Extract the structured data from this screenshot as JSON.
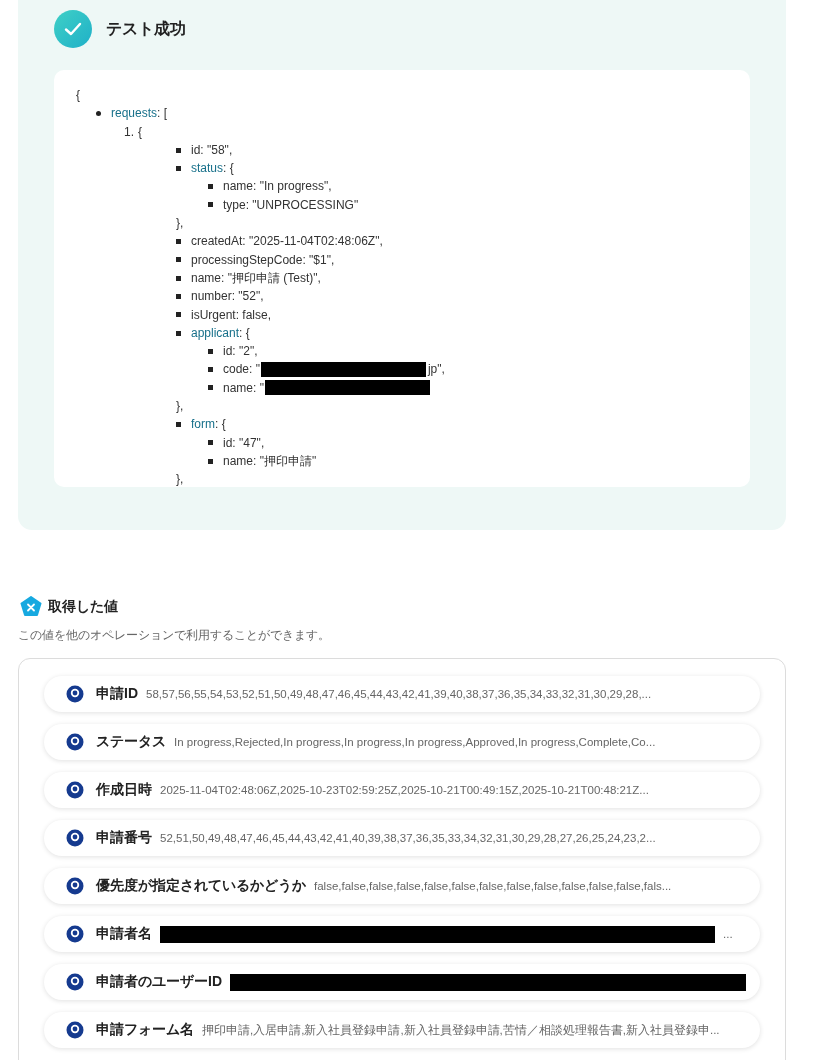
{
  "test_result": {
    "title": "テスト成功",
    "success": true,
    "json_view": {
      "open": "{",
      "items": [
        {
          "key": "requests",
          "text": ": [",
          "entries": [
            {
              "marker": "1.",
              "text": "{",
              "fields": [
                {
                  "text": "id: \"58\","
                },
                {
                  "key": "status",
                  "text": ": {",
                  "children": [
                    {
                      "text": "name: \"In progress\","
                    },
                    {
                      "text": "type: \"UNPROCESSING\""
                    }
                  ],
                  "close": "},"
                },
                {
                  "text": "createdAt: \"2025-11-04T02:48:06Z\","
                },
                {
                  "text": "processingStepCode: \"$1\","
                },
                {
                  "text": "name: \"押印申請 (Test)\","
                },
                {
                  "text": "number: \"52\","
                },
                {
                  "text": "isUrgent: false,"
                },
                {
                  "key": "applicant",
                  "text": ": {",
                  "children": [
                    {
                      "text": "id: \"2\","
                    },
                    {
                      "text": "code: \"",
                      "redacted": true,
                      "after": "jp\","
                    },
                    {
                      "text": "name: \"",
                      "redacted": true
                    }
                  ],
                  "close": "},"
                },
                {
                  "key": "form",
                  "text": ": {",
                  "children": [
                    {
                      "text": "id: \"47\","
                    },
                    {
                      "text": "name: \"押印申請\""
                    }
                  ],
                  "close": "},"
                }
              ]
            }
          ]
        }
      ]
    }
  },
  "outputs": {
    "title": "取得した値",
    "description": "この値を他のオペレーションで利用することができます。",
    "items": [
      {
        "label": "申請ID",
        "value": "58,57,56,55,54,53,52,51,50,49,48,47,46,45,44,43,42,41,39,40,38,37,36,35,34,33,32,31,30,29,28,...",
        "redacted": false
      },
      {
        "label": "ステータス",
        "value": "In progress,Rejected,In progress,In progress,In progress,Approved,In progress,Complete,Co...",
        "redacted": false
      },
      {
        "label": "作成日時",
        "value": "2025-11-04T02:48:06Z,2025-10-23T02:59:25Z,2025-10-21T00:49:15Z,2025-10-21T00:48:21Z...",
        "redacted": false
      },
      {
        "label": "申請番号",
        "value": "52,51,50,49,48,47,46,45,44,43,42,41,40,39,38,37,36,35,33,34,32,31,30,29,28,27,26,25,24,23,2...",
        "redacted": false
      },
      {
        "label": "優先度が指定されているかどうか",
        "value": "false,false,false,false,false,false,false,false,false,false,false,false,fals...",
        "redacted": false
      },
      {
        "label": "申請者名",
        "value": "...",
        "redacted": true
      },
      {
        "label": "申請者のユーザーID",
        "redacted": true
      },
      {
        "label": "申請フォーム名",
        "value": "押印申請,入居申請,新入社員登録申請,新入社員登録申請,苦情／相談処理報告書,新入社員登録申...",
        "redacted": false
      }
    ]
  }
}
